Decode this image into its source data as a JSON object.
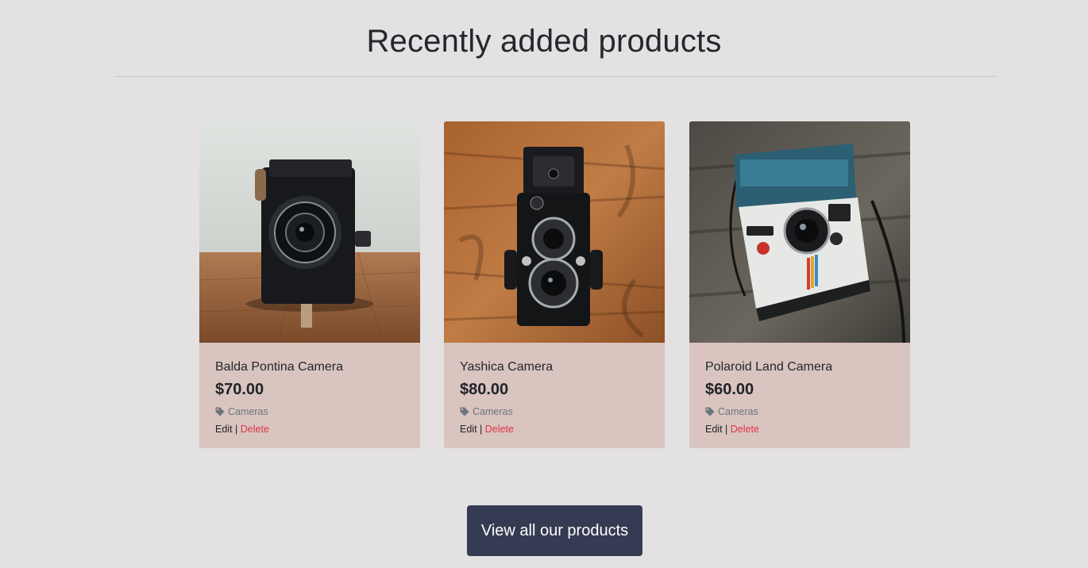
{
  "section": {
    "title": "Recently added products"
  },
  "products": [
    {
      "name": "Balda Pontina Camera",
      "price": "$70.00",
      "category": "Cameras",
      "edit_label": "Edit",
      "separator": "|",
      "delete_label": "Delete"
    },
    {
      "name": "Yashica Camera",
      "price": "$80.00",
      "category": "Cameras",
      "edit_label": "Edit",
      "separator": "|",
      "delete_label": "Delete"
    },
    {
      "name": "Polaroid Land Camera",
      "price": "$60.00",
      "category": "Cameras",
      "edit_label": "Edit",
      "separator": "|",
      "delete_label": "Delete"
    }
  ],
  "cta": {
    "label": "View all our products"
  },
  "colors": {
    "background": "#e3e1e2",
    "card": "#d9c4bf",
    "button": "#353b52",
    "delete": "#dc3545",
    "muted": "#6c757d"
  },
  "icons": {
    "category": "tag-icon"
  }
}
